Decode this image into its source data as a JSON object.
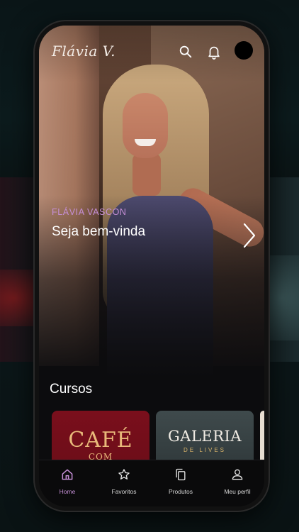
{
  "app": {
    "logo_text": "Flávia V.",
    "accent_color": "#c58fd6"
  },
  "header": {
    "icons": [
      "search-icon",
      "bell-icon",
      "avatar"
    ]
  },
  "hero": {
    "kicker": "FLÁVIA VASCON",
    "title": "Seja bem-vinda",
    "next_icon": "chevron-right-icon"
  },
  "courses": {
    "title": "Cursos",
    "cards": [
      {
        "line1": "CAFÉ",
        "line2": "COM"
      },
      {
        "line1": "GALERIA",
        "line2": "DE LIVES"
      }
    ]
  },
  "nav": {
    "items": [
      {
        "label": "Home",
        "icon": "home-icon",
        "active": true
      },
      {
        "label": "Favoritos",
        "icon": "star-icon",
        "active": false
      },
      {
        "label": "Produtos",
        "icon": "copy-icon",
        "active": false
      },
      {
        "label": "Meu perfil",
        "icon": "user-icon",
        "active": false
      }
    ]
  }
}
